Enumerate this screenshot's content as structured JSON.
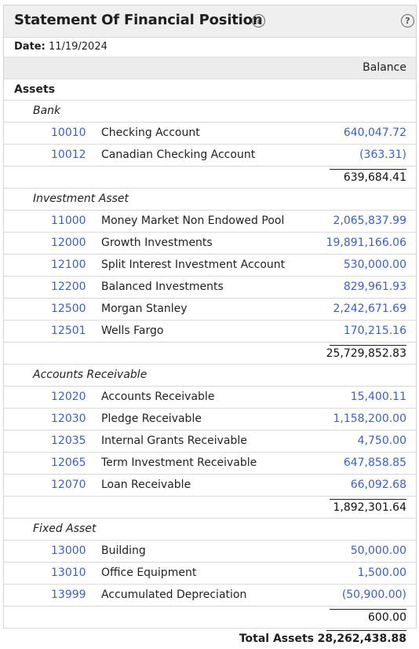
{
  "header": {
    "title": "Statement Of Financial Position"
  },
  "date": {
    "label": "Date:",
    "value": "11/19/2024"
  },
  "column": {
    "balance": "Balance"
  },
  "section": {
    "label": "Assets"
  },
  "groups": [
    {
      "name": "Bank",
      "rows": [
        {
          "code": "10010",
          "name": "Checking Account",
          "amount": "640,047.72"
        },
        {
          "code": "10012",
          "name": "Canadian Checking Account",
          "amount": "(363.31)"
        }
      ],
      "subtotal": "639,684.41"
    },
    {
      "name": "Investment Asset",
      "rows": [
        {
          "code": "11000",
          "name": "Money Market Non Endowed Pool",
          "amount": "2,065,837.99"
        },
        {
          "code": "12000",
          "name": "Growth Investments",
          "amount": "19,891,166.06"
        },
        {
          "code": "12100",
          "name": "Split Interest Investment Account",
          "amount": "530,000.00"
        },
        {
          "code": "12200",
          "name": "Balanced Investments",
          "amount": "829,961.93"
        },
        {
          "code": "12500",
          "name": "Morgan Stanley",
          "amount": "2,242,671.69"
        },
        {
          "code": "12501",
          "name": "Wells Fargo",
          "amount": "170,215.16"
        }
      ],
      "subtotal": "25,729,852.83"
    },
    {
      "name": "Accounts Receivable",
      "rows": [
        {
          "code": "12020",
          "name": "Accounts Receivable",
          "amount": "15,400.11"
        },
        {
          "code": "12030",
          "name": "Pledge Receivable",
          "amount": "1,158,200.00"
        },
        {
          "code": "12035",
          "name": "Internal Grants Receivable",
          "amount": "4,750.00"
        },
        {
          "code": "12065",
          "name": "Term Investment Receivable",
          "amount": "647,858.85"
        },
        {
          "code": "12070",
          "name": "Loan Receivable",
          "amount": "66,092.68"
        }
      ],
      "subtotal": "1,892,301.64"
    },
    {
      "name": "Fixed Asset",
      "rows": [
        {
          "code": "13000",
          "name": "Building",
          "amount": "50,000.00"
        },
        {
          "code": "13010",
          "name": "Office Equipment",
          "amount": "1,500.00"
        },
        {
          "code": "13999",
          "name": "Accumulated Depreciation",
          "amount": "(50,900.00)"
        }
      ],
      "subtotal": "600.00"
    }
  ],
  "total": {
    "label": "Total Assets",
    "value": "28,262,438.88"
  }
}
